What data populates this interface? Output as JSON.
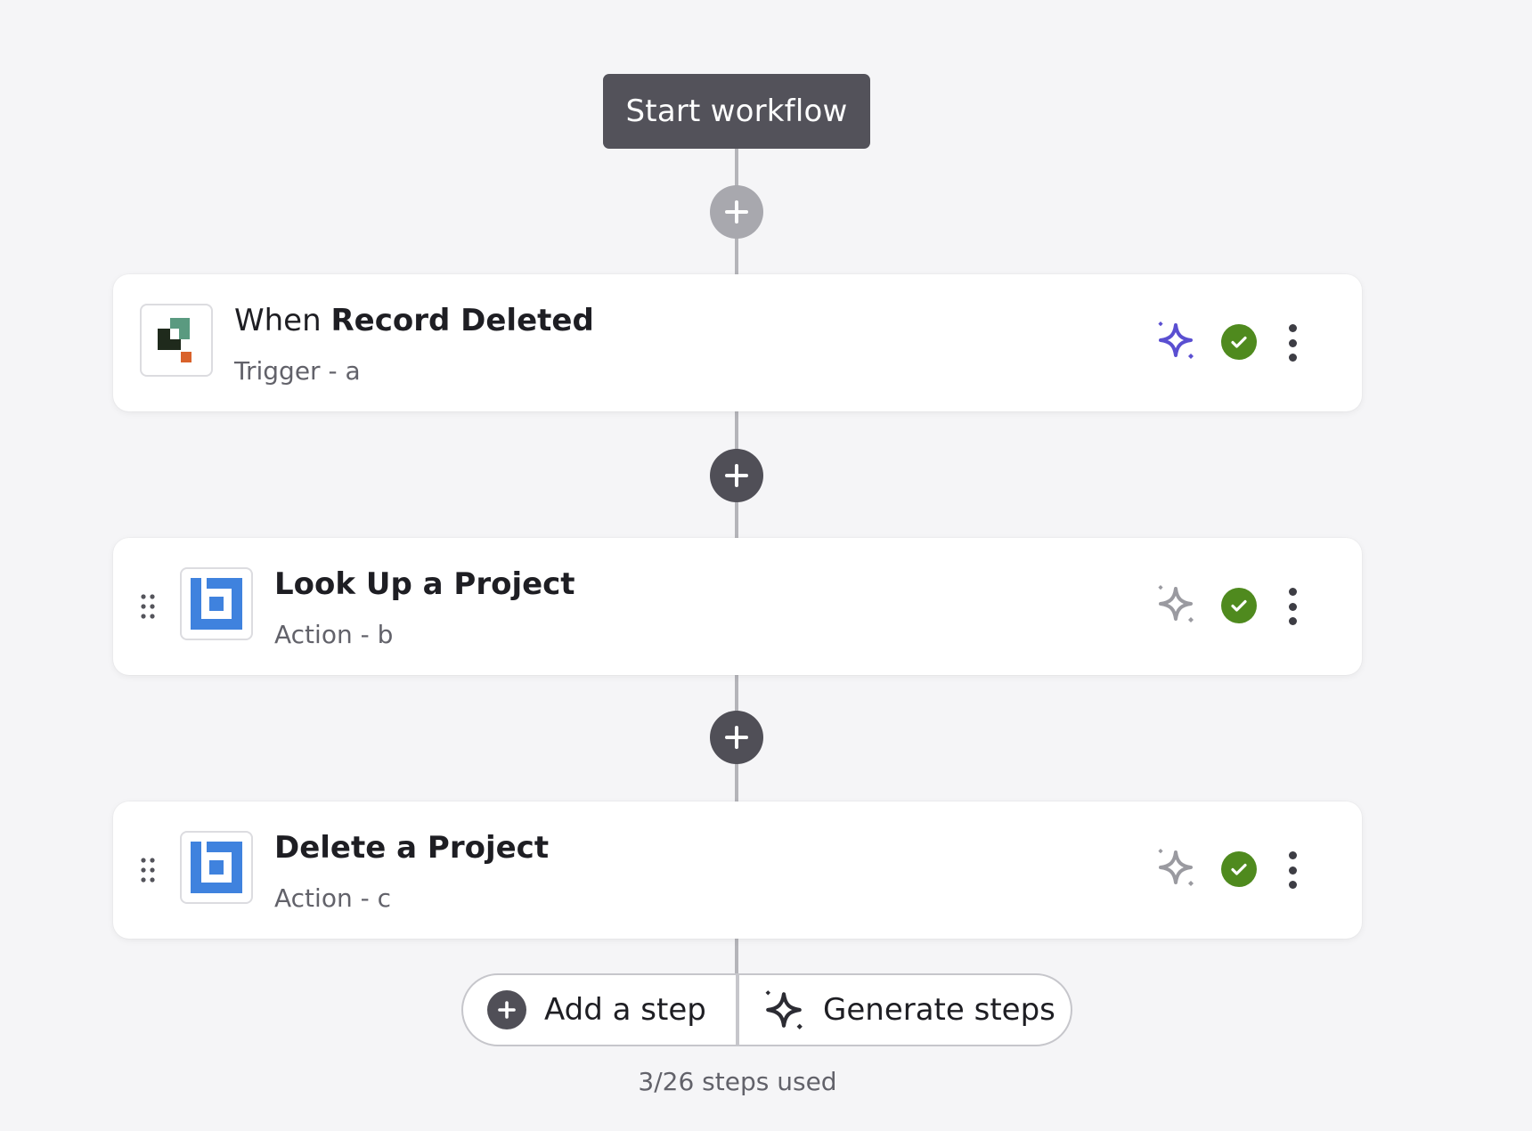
{
  "start": {
    "label": "Start workflow"
  },
  "steps": [
    {
      "title_prefix": "When ",
      "title": "Record Deleted",
      "subtitle": "Trigger - a",
      "kind": "trigger",
      "ai_icon": "sparkle-icon-active",
      "status": "complete",
      "status_color": "#4f8a1e"
    },
    {
      "title_prefix": "",
      "title": "Look Up a Project",
      "subtitle": "Action - b",
      "kind": "action",
      "ai_icon": "sparkle-icon-inactive",
      "status": "complete",
      "status_color": "#4f8a1e"
    },
    {
      "title_prefix": "",
      "title": "Delete a Project",
      "subtitle": "Action - c",
      "kind": "action",
      "ai_icon": "sparkle-icon-inactive",
      "status": "complete",
      "status_color": "#4f8a1e"
    }
  ],
  "bottom": {
    "add_label": "Add a step",
    "generate_label": "Generate steps",
    "steps_used": "3/26 steps used"
  },
  "colors": {
    "accent_sparkle": "#5a4fd1",
    "inactive_sparkle": "#9a9aa0",
    "app_blue": "#3f82de",
    "trigger_green": "#5a9a80",
    "trigger_orange": "#d9622b",
    "dark": "#504f57"
  }
}
